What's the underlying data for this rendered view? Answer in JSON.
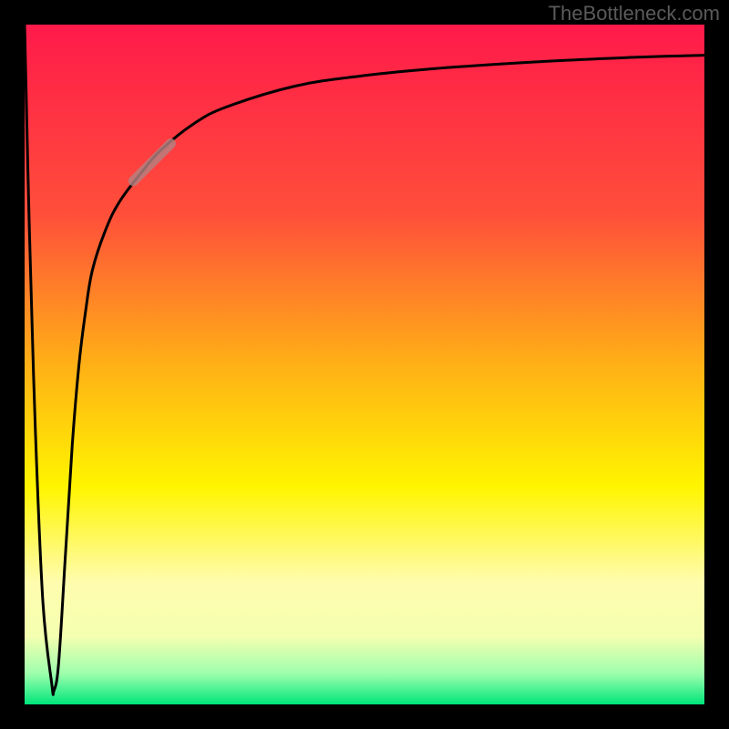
{
  "attribution": "TheBottleneck.com",
  "colors": {
    "frame": "#000000",
    "curve": "#000000",
    "marker": "#b48282",
    "gradient_stops": [
      {
        "offset": 0.0,
        "color": "#ff1a4a"
      },
      {
        "offset": 0.28,
        "color": "#ff4f3a"
      },
      {
        "offset": 0.5,
        "color": "#ffb016"
      },
      {
        "offset": 0.68,
        "color": "#fff500"
      },
      {
        "offset": 0.82,
        "color": "#fffcae"
      },
      {
        "offset": 0.9,
        "color": "#f4ffb0"
      },
      {
        "offset": 0.955,
        "color": "#9dffad"
      },
      {
        "offset": 1.0,
        "color": "#00e57a"
      }
    ]
  },
  "chart_data": {
    "type": "line",
    "title": "",
    "xlabel": "",
    "ylabel": "",
    "xlim": [
      0,
      100
    ],
    "ylim": [
      0,
      100
    ],
    "note": "Axis values are normalized percentages estimated from pixel positions; the chart has no printed tick labels.",
    "series": [
      {
        "name": "bottleneck-curve",
        "x": [
          0.0,
          0.7,
          1.6,
          2.7,
          4.0,
          4.3,
          5.0,
          6.0,
          7.0,
          8.0,
          9.0,
          10.0,
          12.0,
          14.0,
          17.0,
          20.0,
          25.0,
          30.0,
          40.0,
          50.0,
          60.0,
          75.0,
          90.0,
          100.0
        ],
        "y": [
          100.0,
          70.0,
          40.0,
          15.0,
          3.0,
          2.0,
          6.0,
          22.0,
          38.0,
          50.0,
          58.0,
          64.0,
          70.0,
          74.0,
          78.0,
          81.5,
          85.5,
          88.0,
          91.0,
          92.5,
          93.5,
          94.5,
          95.2,
          95.5
        ]
      }
    ],
    "marker": {
      "x_start": 16.0,
      "x_end": 21.5,
      "y_start": 77.0,
      "y_end": 82.5
    }
  }
}
